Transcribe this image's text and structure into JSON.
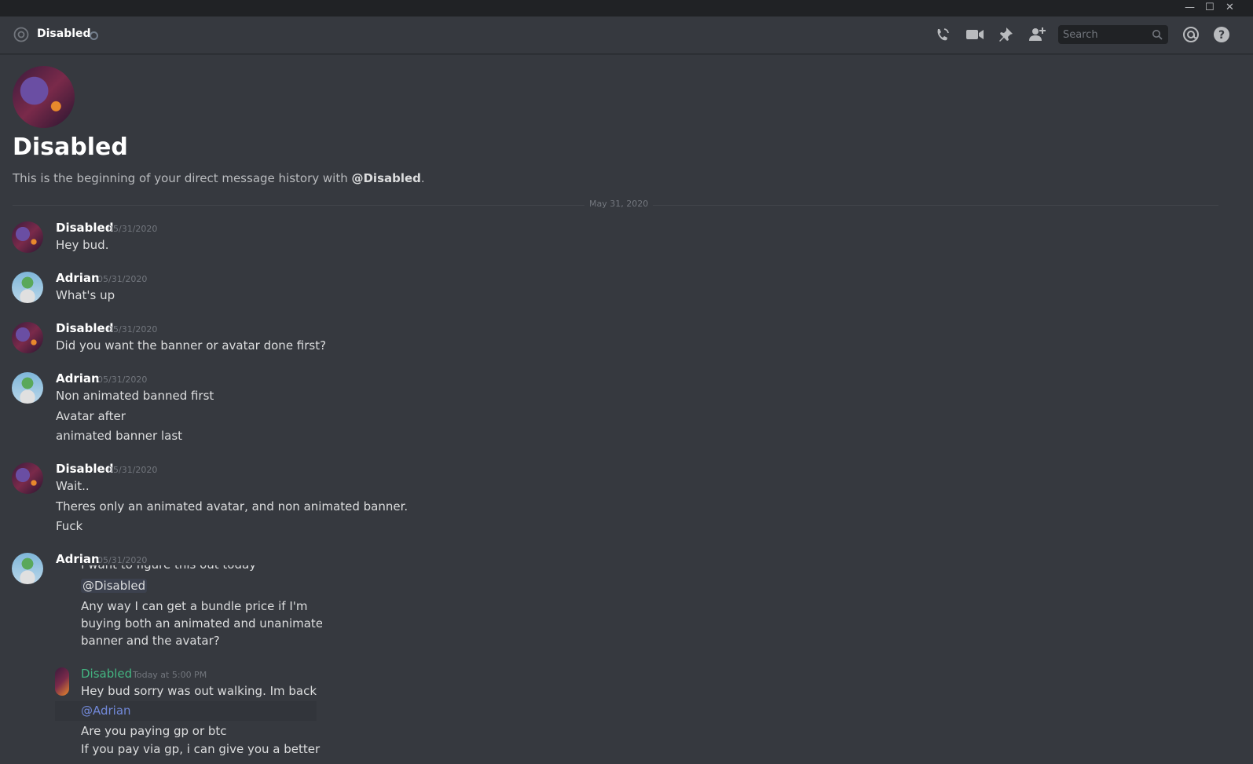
{
  "window": {
    "min": "—",
    "max": "☐",
    "close": "✕"
  },
  "header": {
    "channel_name": "Disabled",
    "icons": [
      "at-icon",
      "voice-call-icon",
      "video-call-icon",
      "pin-icon",
      "add-friend-icon",
      "mentions-icon",
      "help-icon"
    ],
    "search_placeholder": "Search"
  },
  "intro": {
    "name": "Disabled",
    "desc_prefix": "This is the beginning of your direct message history with ",
    "desc_user": "@Disabled",
    "desc_suffix": "."
  },
  "divider": {
    "date": "May 31, 2020"
  },
  "messages": [
    {
      "author": "Disabled",
      "timestamp": "05/31/2020",
      "lines": [
        "Hey bud."
      ]
    },
    {
      "author": "Adrian",
      "timestamp": "05/31/2020",
      "lines": [
        "What's up"
      ]
    },
    {
      "author": "Disabled",
      "timestamp": "05/31/2020",
      "lines": [
        "Did you want the banner or avatar done first?"
      ]
    },
    {
      "author": "Adrian",
      "timestamp": "05/31/2020",
      "lines": [
        "Non animated banned first",
        "Avatar after",
        "animated banner last"
      ]
    },
    {
      "author": "Disabled",
      "timestamp": "05/31/2020",
      "lines": [
        "Wait..",
        "Theres only an animated avatar, and non animated banner.",
        "Fuck"
      ]
    },
    {
      "author": "Adrian",
      "timestamp": "05/31/2020",
      "lines": []
    }
  ],
  "embed": {
    "cut_top": "I want to figure this out today",
    "mention1": "@Disabled",
    "question": [
      "Any way I can get a bundle price if I'm",
      "buying both an animated and unanimated",
      "banner and the avatar?"
    ],
    "reply_author": "Disabled",
    "reply_timestamp": "Today at 5:00 PM",
    "reply_line1": "Hey bud sorry was out walking. Im back",
    "mention2": "@Adrian",
    "reply_line2": "Are you paying gp or btc",
    "reply_line3": "If you pay via gp, i can give you a better"
  },
  "colors": {
    "background": "#36393f",
    "mention": "#7289da",
    "reply_author": "#43b581"
  }
}
